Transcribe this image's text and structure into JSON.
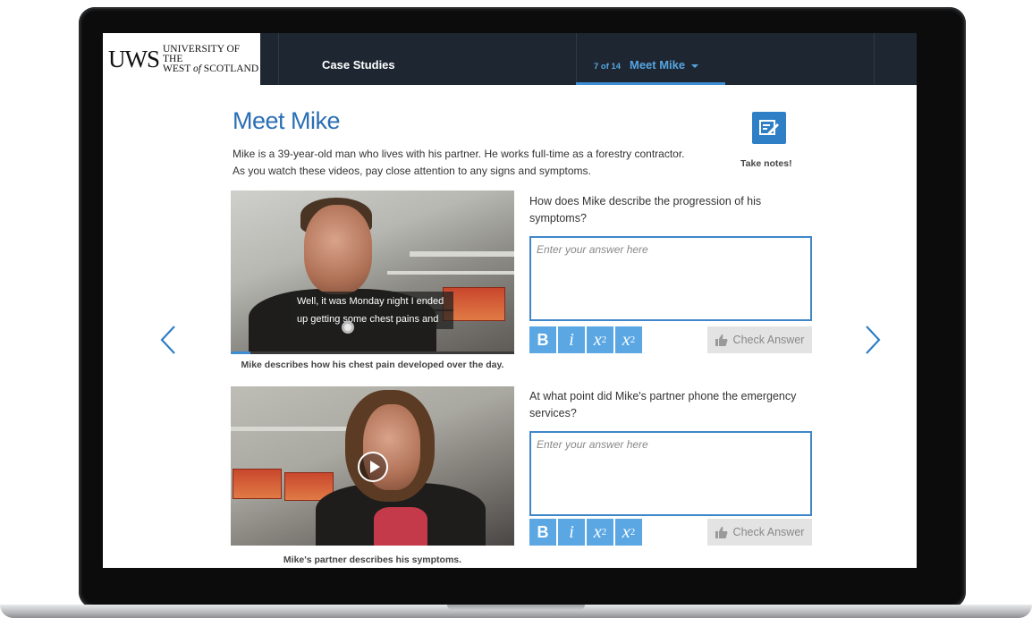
{
  "nav": {
    "logo_mark": "UWS",
    "logo_line1": "UNIVERSITY OF THE",
    "logo_line2_a": "WEST ",
    "logo_line2_b": "of",
    "logo_line2_c": " SCOTLAND",
    "section": "Case Studies",
    "counter": "7 of 14",
    "page_title": "Meet Mike"
  },
  "main": {
    "title": "Meet Mike",
    "intro_line1": "Mike is a 39-year-old man who lives with his partner. He works full-time as a forestry contractor.",
    "intro_line2": "As you watch these videos, pay close attention to any signs and symptoms.",
    "notes_label": "Take notes!"
  },
  "videos": [
    {
      "subtitle_line1": "Well, it was Monday night I ended",
      "subtitle_line2": "up getting some chest pains and",
      "caption": "Mike describes how his chest pain developed over the day.",
      "progress": 0.07
    },
    {
      "caption": "Mike's partner describes his symptoms."
    }
  ],
  "questions": [
    {
      "text": "How does Mike describe the progression of his symptoms?",
      "placeholder": "Enter your answer here",
      "check_label": "Check Answer"
    },
    {
      "text": "At what point did Mike's partner phone the emergency services?",
      "placeholder": "Enter your answer here",
      "check_label": "Check Answer"
    }
  ],
  "toolbar": {
    "bold": "B",
    "italic": "i",
    "sub_base": "x",
    "sub_mark": "2",
    "sup_base": "x",
    "sup_mark": "2"
  },
  "colors": {
    "accent": "#2e7fc6",
    "nav_bg": "#1e2731",
    "title": "#2b6fb4",
    "toolbar_button": "#5aa7e4"
  },
  "icons": {
    "notes": "notes-edit-icon",
    "prev": "chevron-left-icon",
    "next": "chevron-right-icon",
    "check": "thumbs-up-icon",
    "play": "play-icon"
  }
}
